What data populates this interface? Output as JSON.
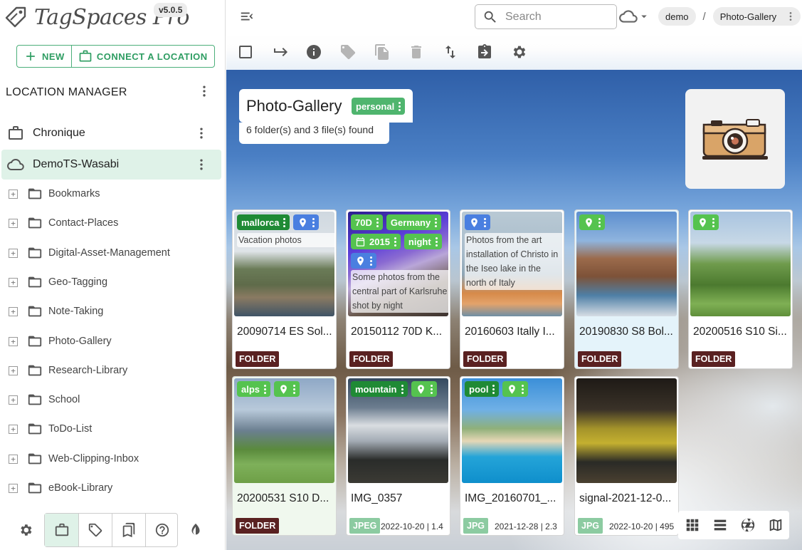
{
  "app": {
    "name": "TagSpaces Pro",
    "version": "v5.0.5",
    "colors": {
      "accent": "#2e9d62",
      "active_bg": "#dff2e8",
      "folder_badge": "#5a2121",
      "tag_green": "#55c34f",
      "tag_dark_green": "#1f8a35",
      "tag_blue": "#4a7fe0"
    }
  },
  "sidebar": {
    "new_label": "NEW",
    "connect_label": "CONNECT A LOCATION",
    "location_manager_title": "LOCATION MANAGER",
    "locations": [
      {
        "name": "Chronique",
        "icon": "briefcase-icon",
        "active": false
      },
      {
        "name": "DemoTS-Wasabi",
        "icon": "cloud-icon",
        "active": true
      }
    ],
    "folders": [
      "Bookmarks",
      "Contact-Places",
      "Digital-Asset-Management",
      "Geo-Tagging",
      "Note-Taking",
      "Photo-Gallery",
      "Research-Library",
      "School",
      "ToDo-List",
      "Web-Clipping-Inbox",
      "eBook-Library"
    ],
    "bottom_icons": [
      "settings-icon",
      "locations-icon",
      "tags-icon",
      "bookmarks-icon",
      "help-icon",
      "theme-icon"
    ]
  },
  "topbar": {
    "search_placeholder": "Search",
    "breadcrumb": [
      "demo",
      "Photo-Gallery"
    ]
  },
  "toolbar": {
    "icons": [
      "select-all-icon",
      "parent-folder-icon",
      "info-icon",
      "tag-icon",
      "copy-icon",
      "delete-icon",
      "sort-icon",
      "import-icon",
      "settings-icon"
    ]
  },
  "folder": {
    "title": "Photo-Gallery",
    "tag": "personal",
    "found_text": "6 folder(s) and 3 file(s) found"
  },
  "entries": [
    {
      "name": "20090714 ES Sol...",
      "type": "FOLDER",
      "tags": [
        "mallorca"
      ],
      "desc": "Vacation photos",
      "meta": ""
    },
    {
      "name": "20150112 70D K...",
      "type": "FOLDER",
      "tags": [
        "70D",
        "Germany",
        "2015",
        "night"
      ],
      "desc": "Some photos from the central part of Karlsruhe shot by night",
      "meta": ""
    },
    {
      "name": "20160603 Itally I...",
      "type": "FOLDER",
      "tags": [],
      "desc": "Photos from the art installation of Christo in the Iseo lake in the north of Italy",
      "meta": ""
    },
    {
      "name": "20190830 S8 Bol...",
      "type": "FOLDER",
      "tags": [],
      "desc": "",
      "meta": ""
    },
    {
      "name": "20200516 S10 Si...",
      "type": "FOLDER",
      "tags": [],
      "desc": "",
      "meta": ""
    },
    {
      "name": "20200531 S10 D...",
      "type": "FOLDER",
      "tags": [
        "alps"
      ],
      "desc": "",
      "meta": ""
    },
    {
      "name": "IMG_0357",
      "type": "JPEG",
      "tags": [
        "mountain"
      ],
      "desc": "",
      "meta": "2022-10-20 | 1.4"
    },
    {
      "name": "IMG_20160701_...",
      "type": "JPG",
      "tags": [
        "pool"
      ],
      "desc": "",
      "meta": "2021-12-28 | 2.3"
    },
    {
      "name": "signal-2021-12-0...",
      "type": "JPG",
      "tags": [],
      "desc": "",
      "meta": "2022-10-20 | 495"
    }
  ],
  "view_modes": [
    "grid-view-icon",
    "list-view-icon",
    "gallery-view-icon",
    "map-view-icon"
  ]
}
